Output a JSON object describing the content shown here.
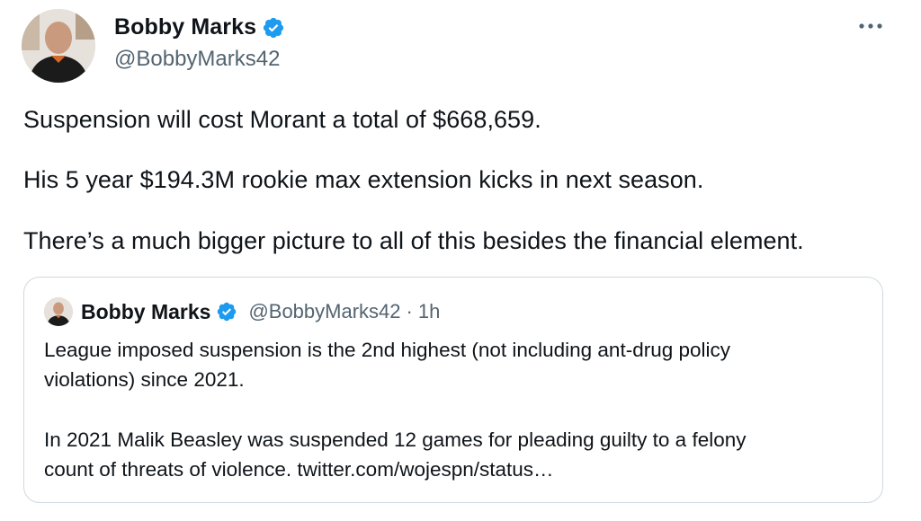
{
  "author": {
    "name": "Bobby Marks",
    "handle": "@BobbyMarks42"
  },
  "tweet": {
    "line1": "Suspension will cost Morant a total of $668,659.",
    "line2": "His 5 year $194.3M rookie max extension kicks in next season.",
    "line3": "There’s a much bigger picture to all of this besides the financial element."
  },
  "quote": {
    "name": "Bobby Marks",
    "handle": "@BobbyMarks42",
    "separator": "·",
    "time": "1h",
    "line1": "League imposed suspension is the 2nd highest (not including ant-drug policy",
    "line2": "violations) since 2021.",
    "line3": "In 2021 Malik Beasley was suspended 12 games for pleading guilty to a felony",
    "line4": "count of threats of violence. twitter.com/wojespn/status…"
  },
  "icons": {
    "verified": "verified-badge-icon",
    "more": "more-options-icon"
  },
  "colors": {
    "verified": "#1d9bf0",
    "text": "#0f1419",
    "secondary": "#536471",
    "border": "#cfd9de"
  }
}
